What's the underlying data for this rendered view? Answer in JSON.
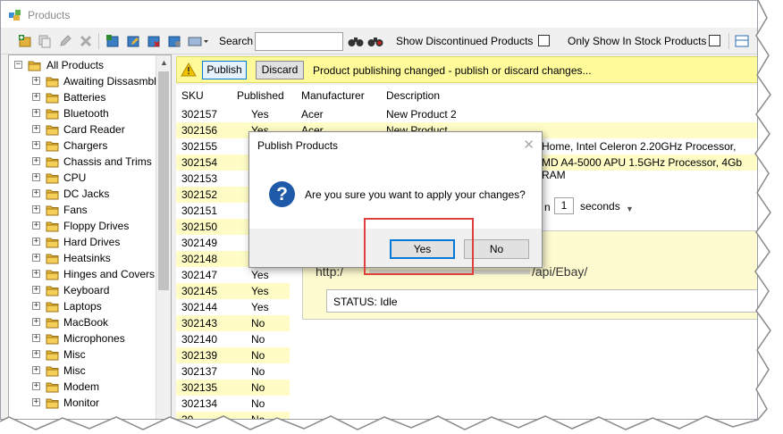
{
  "window": {
    "title": "Products"
  },
  "toolbar": {
    "search_label": "Search",
    "search_value": "",
    "show_discontinued_label": "Show Discontinued Products",
    "show_in_stock_label": "Only Show In Stock Products",
    "show_discontinued_checked": false,
    "show_in_stock_checked": false
  },
  "tree": {
    "root_label": "All Products",
    "items": [
      "Awaiting Dissasmbly",
      "Batteries",
      "Bluetooth",
      "Card Reader",
      "Chargers",
      "Chassis and Trims",
      "CPU",
      "DC Jacks",
      "Fans",
      "Floppy Drives",
      "Hard Drives",
      "Heatsinks",
      "Hinges and Covers",
      "Keyboard",
      "Laptops",
      "MacBook",
      "Microphones",
      "Misc",
      "Misc",
      "Modem",
      "Monitor"
    ]
  },
  "banner": {
    "publish_label": "Publish",
    "discard_label": "Discard",
    "message": "Product publishing changed - publish or discard changes..."
  },
  "grid": {
    "columns": {
      "sku": "SKU",
      "published": "Published",
      "manufacturer": "Manufacturer",
      "description": "Description"
    },
    "rows": [
      {
        "sku": "302157",
        "published": "Yes"
      },
      {
        "sku": "302156",
        "published": "Yes"
      },
      {
        "sku": "302155",
        "published": ""
      },
      {
        "sku": "302154",
        "published": ""
      },
      {
        "sku": "302153",
        "published": ""
      },
      {
        "sku": "302152",
        "published": ""
      },
      {
        "sku": "302151",
        "published": ""
      },
      {
        "sku": "302150",
        "published": ""
      },
      {
        "sku": "302149",
        "published": ""
      },
      {
        "sku": "302148",
        "published": ""
      },
      {
        "sku": "302147",
        "published": "Yes"
      },
      {
        "sku": "302145",
        "published": "Yes"
      },
      {
        "sku": "302144",
        "published": "Yes"
      },
      {
        "sku": "302143",
        "published": "No"
      },
      {
        "sku": "302140",
        "published": "No"
      },
      {
        "sku": "302139",
        "published": "No"
      },
      {
        "sku": "302137",
        "published": "No"
      },
      {
        "sku": "302135",
        "published": "No"
      },
      {
        "sku": "302134",
        "published": "No"
      },
      {
        "sku": "30",
        "published": "No"
      }
    ],
    "detail_rows": [
      {
        "manufacturer": "Acer",
        "description": "New Product 2"
      },
      {
        "manufacturer": "Acer",
        "description": "New Product"
      },
      {
        "manufacturer": "",
        "description": "Home, Intel Celeron 2.20GHz Processor, 2Gb RAM"
      },
      {
        "manufacturer": "",
        "description": "MD A4-5000 APU 1.5GHz Processor, 4Gb RAM"
      }
    ]
  },
  "api_panel": {
    "interval_prefix": "n",
    "interval_value": "1",
    "interval_unit": "seconds",
    "url_prefix": "http:/",
    "url_path": "/api/Ebay/",
    "status": "STATUS: Idle"
  },
  "dialog": {
    "title": "Publish Products",
    "message": "Are you sure you want to apply your changes?",
    "yes_label": "Yes",
    "no_label": "No",
    "icon": "question-icon"
  },
  "colors": {
    "banner_bg": "#fffb9b",
    "row_alt": "#fffcc6",
    "highlight": "#e0403c",
    "accent": "#0078d7"
  }
}
